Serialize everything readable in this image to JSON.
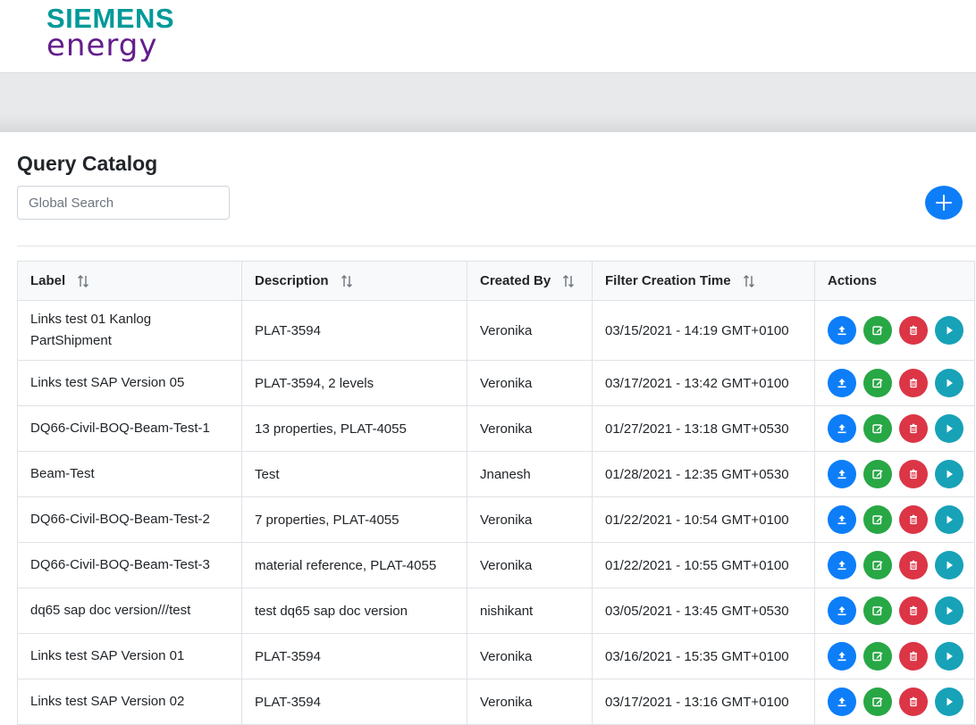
{
  "brand": {
    "line1": "SIEMENS",
    "line2": "energy"
  },
  "page": {
    "title": "Query Catalog"
  },
  "search": {
    "placeholder": "Global Search"
  },
  "colors": {
    "primary": "#0d7ef8",
    "success": "#28a745",
    "danger": "#dc3545",
    "info": "#17a2b8",
    "brand_teal": "#009999",
    "brand_purple": "#641e8c"
  },
  "table": {
    "columns": [
      {
        "label": "Label",
        "sortable": true
      },
      {
        "label": "Description",
        "sortable": true
      },
      {
        "label": "Created By",
        "sortable": true
      },
      {
        "label": "Filter Creation Time",
        "sortable": true
      },
      {
        "label": "Actions",
        "sortable": false
      }
    ],
    "rows": [
      {
        "label": "Links test 01 Kanlog PartShipment",
        "description": "PLAT-3594",
        "created_by": "Veronika",
        "time": "03/15/2021 - 14:19 GMT+0100"
      },
      {
        "label": "Links test SAP Version 05",
        "description": "PLAT-3594, 2 levels",
        "created_by": "Veronika",
        "time": "03/17/2021 - 13:42 GMT+0100"
      },
      {
        "label": "DQ66-Civil-BOQ-Beam-Test-1",
        "description": "13 properties, PLAT-4055",
        "created_by": "Veronika",
        "time": "01/27/2021 - 13:18 GMT+0530"
      },
      {
        "label": "Beam-Test",
        "description": "Test",
        "created_by": "Jnanesh",
        "time": "01/28/2021 - 12:35 GMT+0530"
      },
      {
        "label": "DQ66-Civil-BOQ-Beam-Test-2",
        "description": "7 properties, PLAT-4055",
        "created_by": "Veronika",
        "time": "01/22/2021 - 10:54 GMT+0100"
      },
      {
        "label": "DQ66-Civil-BOQ-Beam-Test-3",
        "description": "material reference, PLAT-4055",
        "created_by": "Veronika",
        "time": "01/22/2021 - 10:55 GMT+0100"
      },
      {
        "label": "dq65 sap doc version///test",
        "description": "test dq65 sap doc version",
        "created_by": "nishikant",
        "time": "03/05/2021 - 13:45 GMT+0530"
      },
      {
        "label": "Links test SAP Version 01",
        "description": "PLAT-3594",
        "created_by": "Veronika",
        "time": "03/16/2021 - 15:35 GMT+0100"
      },
      {
        "label": "Links test SAP Version 02",
        "description": "PLAT-3594",
        "created_by": "Veronika",
        "time": "03/17/2021 - 13:16 GMT+0100"
      }
    ],
    "row_actions": [
      {
        "name": "upload",
        "icon": "upload-icon"
      },
      {
        "name": "edit",
        "icon": "edit-icon"
      },
      {
        "name": "delete",
        "icon": "trash-icon"
      },
      {
        "name": "run",
        "icon": "play-icon"
      }
    ]
  }
}
